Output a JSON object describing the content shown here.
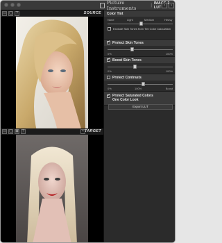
{
  "header": {
    "app_name": "Picture Instruments",
    "separator": "|",
    "product": "IMAGE 2 LUT",
    "prev_glyph": "‹",
    "next_glyph": "›"
  },
  "source": {
    "label": "SOURCE",
    "tools": [
      "▭",
      "▢",
      "?"
    ]
  },
  "target": {
    "label": "TARGET",
    "close_glyph": "×",
    "tools": [
      "▭",
      "▢",
      "▣",
      "?"
    ]
  },
  "panel": {
    "color_tint": {
      "title": "Color Tint",
      "scale": [
        "None",
        "Light",
        "Medium",
        "Heavy"
      ],
      "value": 0.52,
      "exclude_label": "Exclude Skin Tones from Tint Color Calculation",
      "exclude_checked": false
    },
    "protect_skin": {
      "title": "Protect Skin Tones",
      "checked": true,
      "min": "0%",
      "max": "100%",
      "value": 0.38
    },
    "boost_skin": {
      "title": "Boost Skin Tones",
      "checked": true,
      "min": "0%",
      "max": "100%",
      "value": 0.42
    },
    "protect_contrasts": {
      "title": "Protect Contrasts",
      "checked": false,
      "min": "0%",
      "mid": "100%",
      "max": "Boost",
      "value": 0.55
    },
    "protect_saturated": {
      "title_line1": "Protect Saturated Colors",
      "title_line2": "One Color Look",
      "checked": true
    },
    "export_label": "Export LUT"
  },
  "colors": {
    "accent": "#3a3a3a",
    "panel_bg": "#2b2b2b"
  }
}
